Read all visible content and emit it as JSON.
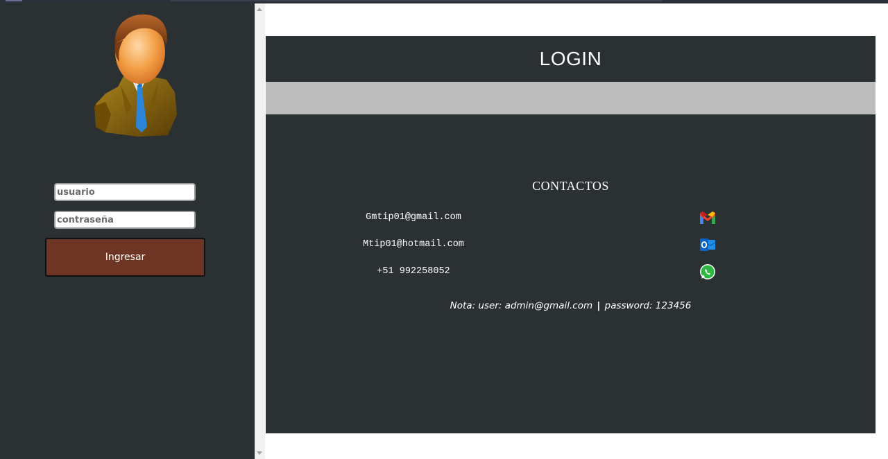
{
  "login_form": {
    "username_placeholder": "usuario",
    "password_placeholder": "contraseña",
    "submit_label": "Ingresar"
  },
  "header": {
    "title": "LOGIN"
  },
  "contacts": {
    "title": "CONTACTOS",
    "items": [
      {
        "text": "Gmtip01@gmail.com",
        "icon": "gmail-icon"
      },
      {
        "text": "Mtip01@hotmail.com",
        "icon": "outlook-icon"
      },
      {
        "text": "+51 992258052",
        "icon": "whatsapp-icon"
      }
    ]
  },
  "note": {
    "part1": "Nota: user: admin@gmail.com",
    "separator": "|",
    "part2": "password: 123456"
  },
  "colors": {
    "panel": "#2b3133",
    "band": "#bdbdbd",
    "button": "#6e3525"
  }
}
